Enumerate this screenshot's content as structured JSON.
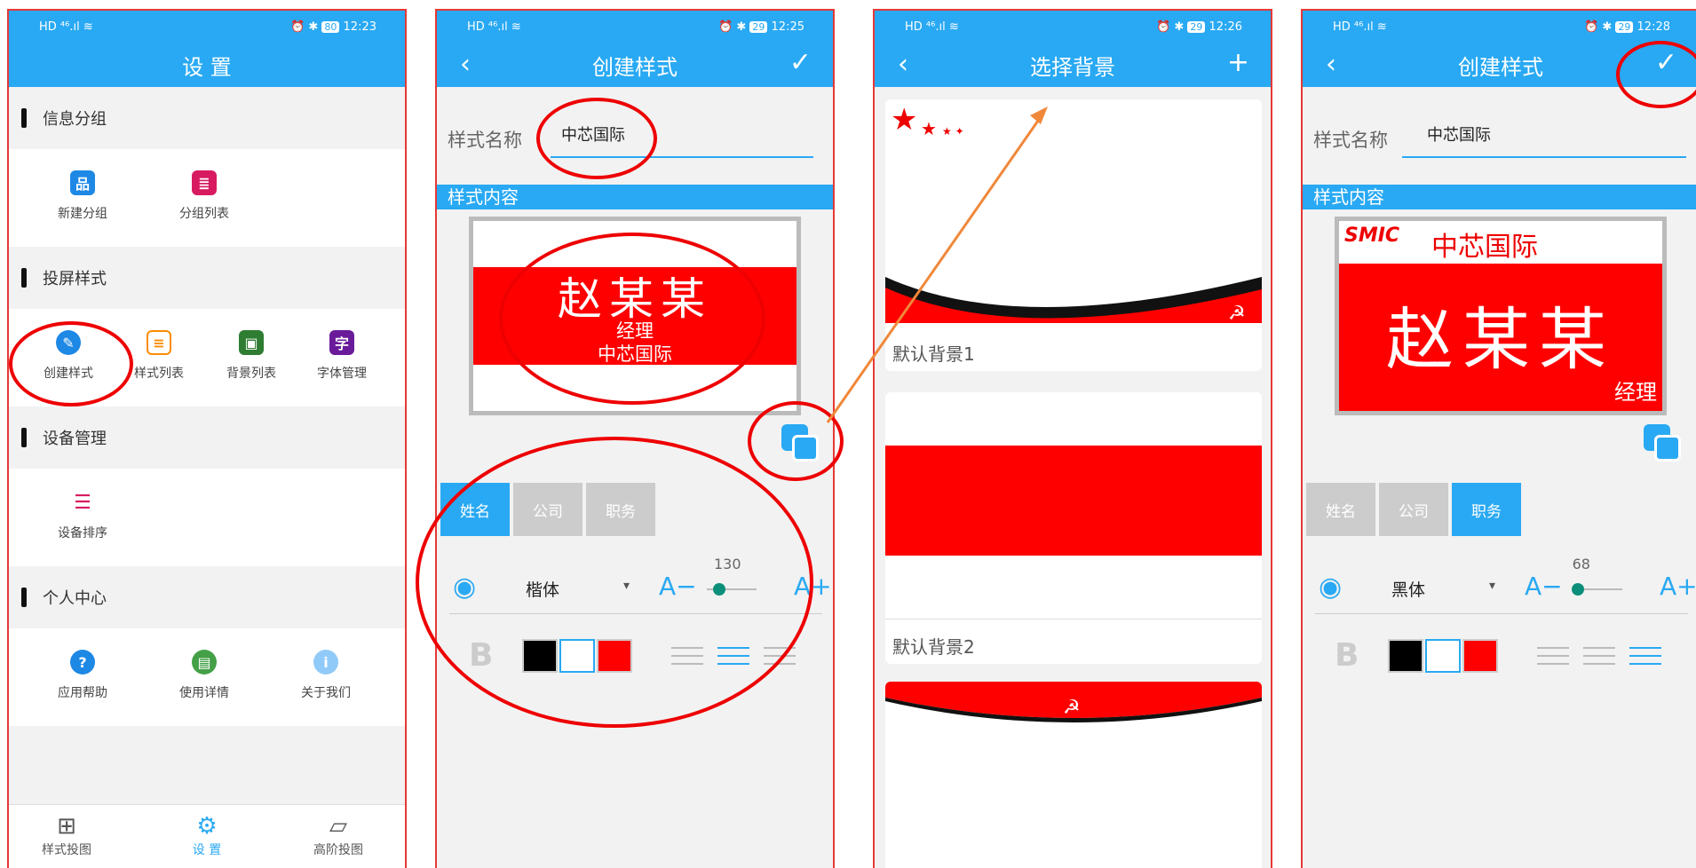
{
  "status": {
    "icons": "HD ⁴⁶.ıl ≋",
    "right_icons": "⏰ ✱",
    "battery": [
      80,
      29,
      29,
      29
    ],
    "times": [
      "12:23",
      "12:25",
      "12:26",
      "12:28"
    ]
  },
  "p1": {
    "title": "设 置",
    "sections": [
      {
        "label": "信息分组",
        "items": [
          "新建分组",
          "分组列表"
        ]
      },
      {
        "label": "投屏样式",
        "items": [
          "创建样式",
          "样式列表",
          "背景列表",
          "字体管理"
        ]
      },
      {
        "label": "设备管理",
        "items": [
          "设备排序"
        ]
      },
      {
        "label": "个人中心",
        "items": [
          "应用帮助",
          "使用详情",
          "关于我们"
        ]
      }
    ],
    "nav": [
      "样式投图",
      "设 置",
      "高阶投图"
    ]
  },
  "p2": {
    "title": "创建样式",
    "field_label": "样式名称",
    "field_value": "中芯国际",
    "band": "样式内容",
    "preview": {
      "name": "赵某某",
      "title": "经理",
      "company": "中芯国际"
    },
    "tabs": [
      "姓名",
      "公司",
      "职务"
    ],
    "active_tab": 0,
    "font": "楷体",
    "size": "130",
    "size_level": 0.25,
    "a_minus": "A−",
    "a_plus": "A+",
    "bold": "B"
  },
  "p3": {
    "title": "选择背景",
    "bgs": [
      "默认背景1",
      "默认背景2"
    ]
  },
  "p4": {
    "title": "创建样式",
    "field_label": "样式名称",
    "field_value": "中芯国际",
    "band": "样式内容",
    "preview": {
      "logo": "SMIC",
      "company": "中芯国际",
      "name": "赵某某",
      "title": "经理"
    },
    "tabs": [
      "姓名",
      "公司",
      "职务"
    ],
    "active_tab": 2,
    "font": "黑体",
    "size": "68",
    "size_level": 0.1,
    "a_minus": "A−",
    "a_plus": "A+",
    "bold": "B"
  },
  "colors": {
    "accent": "#29a9f3",
    "red": "#ff0000",
    "annotation": "#e00000",
    "arrow": "#f0883a"
  }
}
